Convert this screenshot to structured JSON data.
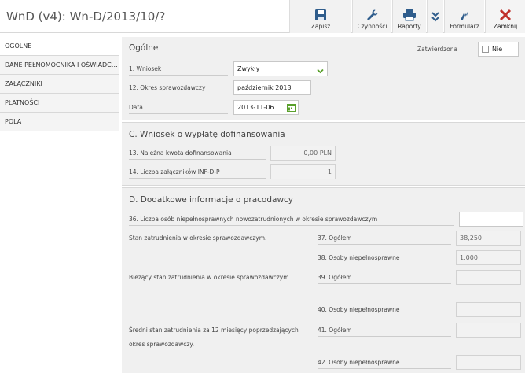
{
  "header": {
    "title": "WnD (v4): Wn-D/2013/10/?",
    "toolbar": {
      "save": "Zapisz",
      "actions": "Czynności",
      "reports": "Raporty",
      "form": "Formularz",
      "close": "Zamknij"
    }
  },
  "sidebar": {
    "items": [
      {
        "label": "OGÓLNE"
      },
      {
        "label": "DANE PEŁNOMOCNIKA I OŚWIADCZENIA"
      },
      {
        "label": "ZAŁĄCZNIKI"
      },
      {
        "label": "PŁATNOŚCI"
      },
      {
        "label": "POLA"
      }
    ]
  },
  "general": {
    "title": "Ogólne",
    "approved_label": "Zatwierdzona",
    "approved_value": "Nie",
    "wniosek_label": "1. Wniosek",
    "wniosek_value": "Zwykły",
    "period_label": "12. Okres sprawozdawczy",
    "period_value": "październik 2013",
    "date_label": "Data",
    "date_value": "2013-11-06"
  },
  "sectionC": {
    "title": "C. Wniosek o wypłatę dofinansowania",
    "amount_label": "13. Należna kwota dofinansowania",
    "amount_value": "0,00 PLN",
    "attachments_label": "14. Liczba załączników INF-D-P",
    "attachments_value": "1"
  },
  "sectionD": {
    "title": "D. Dodatkowe informacje o pracodawcy",
    "f36_label": "36. Liczba osób niepełnosprawnych nowozatrudnionych w okresie sprawozdawczym",
    "f36_value": "",
    "group1_label": "Stan zatrudnienia w okresie sprawozdawczym.",
    "f37_label": "37. Ogółem",
    "f37_value": "38,250",
    "f38_label": "38. Osoby niepełnosprawne",
    "f38_value": "1,000",
    "group2_label": "Bieżący stan zatrudnienia w okresie sprawozdawczym.",
    "f39_label": "39. Ogółem",
    "f39_value": "",
    "f40_label": "40. Osoby niepełnosprawne",
    "f40_value": "",
    "group3_label_line1": "Średni stan zatrudnienia za 12 miesięcy poprzedzających",
    "group3_label_line2": "okres sprawozdawczy.",
    "f41_label": "41. Ogółem",
    "f41_value": "",
    "f42_label": "42. Osoby niepełnosprawne",
    "f42_value": ""
  },
  "icons": {
    "save": "floppy-disk-icon",
    "actions": "wrench-icon",
    "reports": "printer-icon",
    "dropdown": "double-chevron-down-icon",
    "form": "lightning-icon",
    "close": "close-icon",
    "select": "chevron-down-icon",
    "date": "calendar-icon"
  },
  "colors": {
    "accent_green": "#5aa02c",
    "close_red": "#c0312b",
    "icon_blue": "#2f5d8c"
  }
}
